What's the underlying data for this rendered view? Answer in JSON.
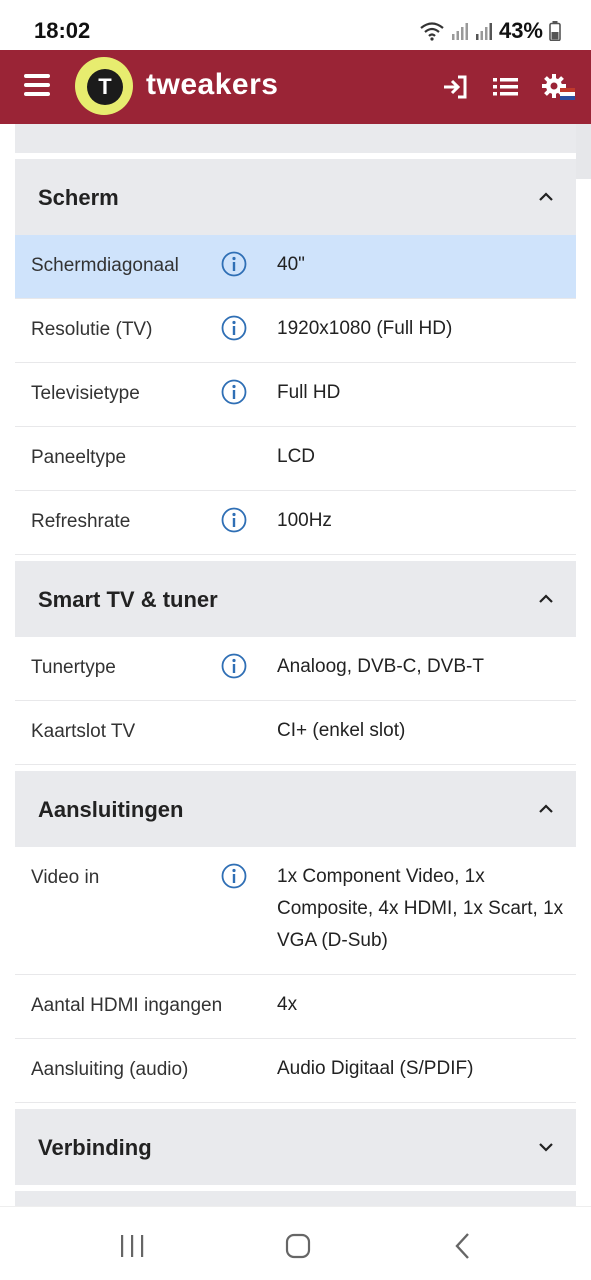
{
  "status_bar": {
    "time": "18:02",
    "battery": "43%"
  },
  "header": {
    "logo_letter": "T",
    "brand": "tweakers"
  },
  "sections": [
    {
      "title": "Scherm",
      "rows": [
        {
          "label": "Schermdiagonaal",
          "value": "40\""
        },
        {
          "label": "Resolutie (TV)",
          "value": "1920x1080 (Full HD)"
        },
        {
          "label": "Televisietype",
          "value": "Full HD"
        },
        {
          "label": "Paneeltype",
          "value": "LCD"
        },
        {
          "label": "Refreshrate",
          "value": "100Hz"
        }
      ]
    },
    {
      "title": "Smart TV & tuner",
      "rows": [
        {
          "label": "Tunertype",
          "value": "Analoog, DVB-C, DVB-T"
        },
        {
          "label": "Kaartslot TV",
          "value": "CI+ (enkel slot)"
        }
      ]
    },
    {
      "title": "Aansluitingen",
      "rows": [
        {
          "label": "Video in",
          "value": "1x Component Video, 1x Composite, 4x HDMI, 1x Scart, 1x VGA (D-Sub)"
        },
        {
          "label": "Aantal HDMI ingangen",
          "value": "4x"
        },
        {
          "label": "Aansluiting (audio)",
          "value": "Audio Digitaal (S/PDIF)"
        }
      ]
    },
    {
      "title": "Verbinding"
    }
  ],
  "colors": {
    "brand": "#9a2436",
    "logo_yellow": "#e7ec6f",
    "highlight": "#cfe3fb",
    "section_bg": "#e9eaed"
  }
}
